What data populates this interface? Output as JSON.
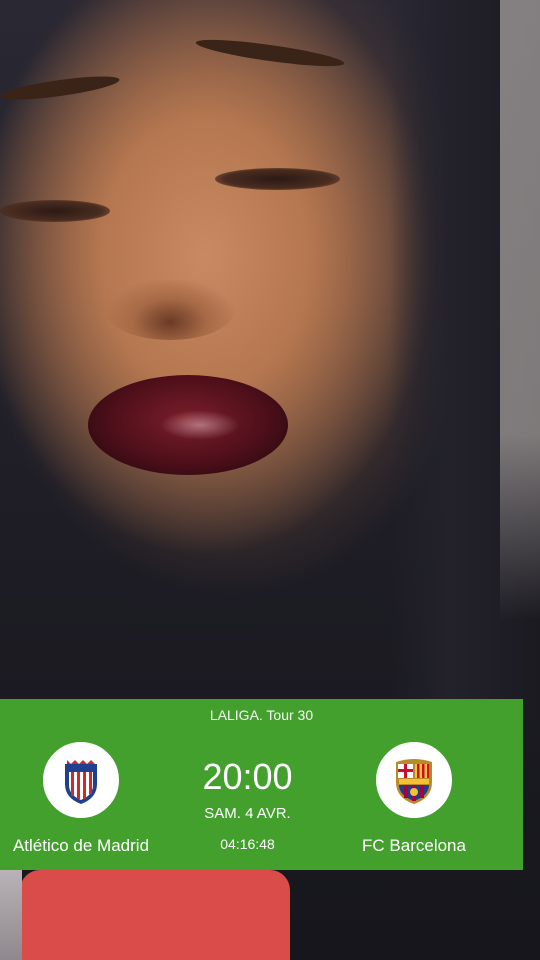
{
  "league": "LALIGA.  Tour 30",
  "match": {
    "home_team": "Atlético de Madrid",
    "away_team": "FC Barcelona",
    "kickoff_time": "20:00",
    "date": "SAM. 4 AVR.",
    "countdown": "04:16:48"
  },
  "colors": {
    "scoreboard_bg": "#43a02d",
    "text": "#ffffff"
  },
  "icons": {
    "home_crest": "atletico-madrid-crest",
    "away_crest": "fc-barcelona-crest"
  }
}
